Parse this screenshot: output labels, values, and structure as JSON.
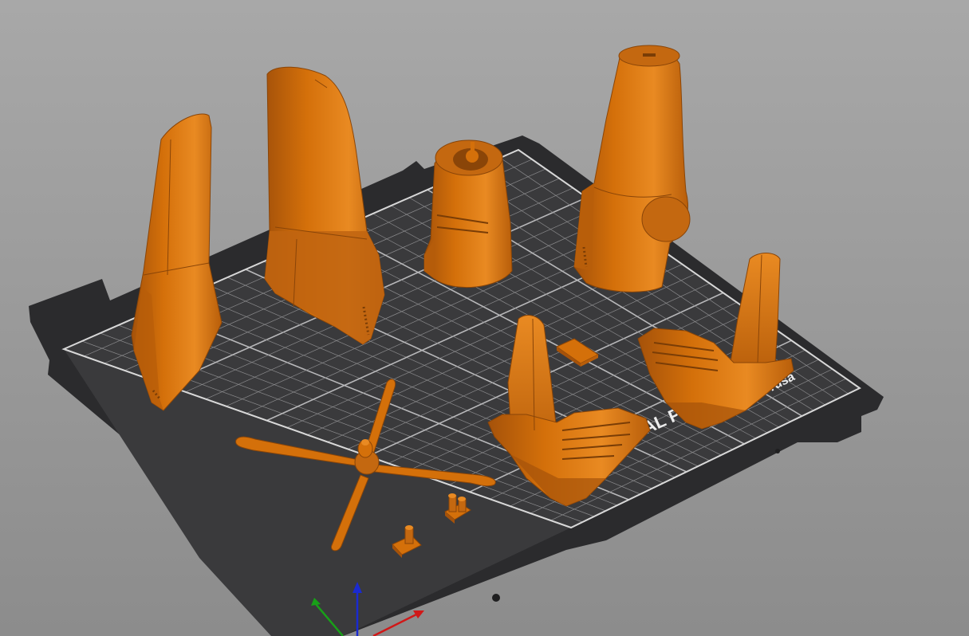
{
  "viewport": {
    "background_top": "#a8a8a8",
    "background_bottom": "#8c8c8c"
  },
  "bed": {
    "label_left": "AL PR",
    "label_right": "l Prusa",
    "plate_color": "#3a3a3c",
    "frame_color": "#2b2b2d",
    "grid_color": "#8a8a8c",
    "border_color": "#d8d8d8"
  },
  "model": {
    "color": "#d4700a",
    "shade_color": "#a5520a",
    "highlight_color": "#e98a22"
  },
  "parts": [
    {
      "name": "wing-half-left"
    },
    {
      "name": "wing-half-right"
    },
    {
      "name": "engine-cowling"
    },
    {
      "name": "fuselage-nose"
    },
    {
      "name": "tail-assembly-front"
    },
    {
      "name": "tail-assembly-back"
    },
    {
      "name": "small-plate"
    },
    {
      "name": "propeller"
    },
    {
      "name": "landing-gear-left"
    },
    {
      "name": "landing-gear-right"
    }
  ],
  "axes": {
    "x_color": "#d01818",
    "y_color": "#18a018",
    "z_color": "#1a2ad0"
  }
}
